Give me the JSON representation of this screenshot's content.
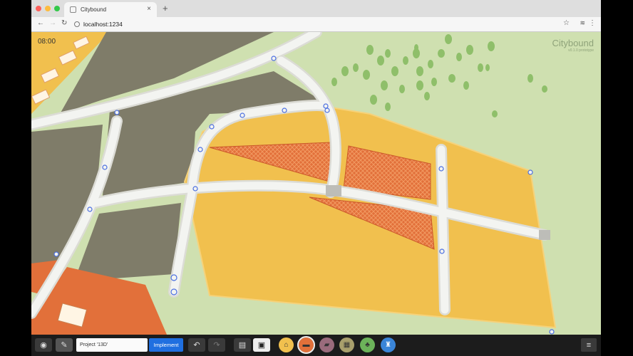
{
  "browser": {
    "tab_title": "Citybound",
    "url": "localhost:1234"
  },
  "game": {
    "clock": "08:00",
    "brand": "Citybound",
    "brand_sub": "v0.1.0 prototype"
  },
  "toolbar": {
    "project_name": "Project '13D'",
    "implement_label": "Implement"
  },
  "colors": {
    "zone_yellow": "#f1c04e",
    "hatched_orange": "#e2703a",
    "grass": "#cfe0b0",
    "park_brown": "#7f7c69",
    "road": "#f3f4f1",
    "implement_blue": "#1f6fe0"
  }
}
